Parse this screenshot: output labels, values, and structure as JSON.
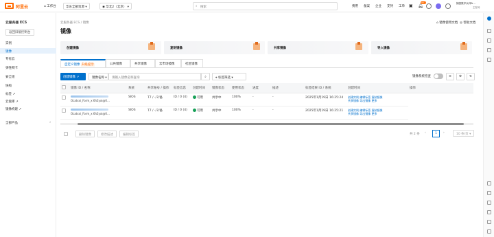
{
  "top": {
    "logo": "阿里云",
    "workbench": "工作台",
    "account": "华东全部资源",
    "region": "华北2（北京）",
    "search_placeholder": "搜索",
    "menu": [
      "费用",
      "备案",
      "企业",
      "支持",
      "工单"
    ],
    "badge": "99+",
    "user_line1": "捕捉数字伙伴&…",
    "user_line2": "主账号"
  },
  "sidebar": {
    "title": "云服务器 ECS",
    "back": "返回旧版控制台",
    "items": [
      "实例",
      "镜像",
      "专有云",
      "弹性网卡",
      "安全组",
      "快照",
      "标签",
      "云盘库",
      "镜像构建"
    ],
    "footer": "全部产品"
  },
  "breadcrumb": "云服务器 ECS  /  镜像",
  "page_title": "镜像",
  "top_links": [
    "镜像使用文档",
    "帮助文档"
  ],
  "cards": [
    "创建镜像",
    "复制镜像",
    "共享镜像",
    "导入镜像"
  ],
  "tabs": [
    "自定义镜像",
    "公共镜像",
    "共享镜像",
    "云市场镜像",
    "社区镜像"
  ],
  "tab_badge": "升级提示",
  "toolbar": {
    "create": "创建镜像",
    "filter": "镜像名称",
    "search_placeholder": "请输入镜像名称查询",
    "tag_filter": "标签筛选",
    "toggle_label": "镜像系统检查"
  },
  "table": {
    "headers": [
      "镜像 ID / 名称",
      "系统",
      "共享账号 / 操作",
      "标签信息",
      "创建时间",
      "镜像状态",
      "使用状态",
      "进度",
      "描述",
      "标签结果 ID / 系统",
      "创建时间",
      "操作"
    ],
    "rows": [
      {
        "name": "Ocatxxi_Form_x 6h2yxi@0…",
        "system": "SIOS",
        "col3": "T7 / -/7/备",
        "col4": "ID / 0 (4)",
        "status": "可用",
        "usage": "共享中",
        "progress": "100%",
        "desc": "-",
        "ids": "-",
        "time": "2025年1月19日 16:25:24",
        "ops": [
          "创建实例",
          "编辑标签",
          "复制镜像",
          "共享镜像",
          "导出镜像",
          "更多"
        ]
      },
      {
        "name": "Ocatxxi_Form_x 6h2yxi@0…",
        "system": "SIOS",
        "col3": "T7 / -/7/备",
        "col4": "ID / 0 (4)",
        "status": "可用",
        "usage": "共享中",
        "progress": "100%",
        "desc": "-",
        "ids": "-",
        "time": "2025年1月19日 16:25:21",
        "ops": [
          "创建实例",
          "编辑标签",
          "复制镜像",
          "共享镜像",
          "导出镜像",
          "更多"
        ]
      }
    ]
  },
  "footer": {
    "buttons": [
      "删除镜像",
      "修改描述",
      "编辑标签"
    ],
    "count": "共 2 条",
    "page": "1",
    "per_page": "10 条/页"
  }
}
